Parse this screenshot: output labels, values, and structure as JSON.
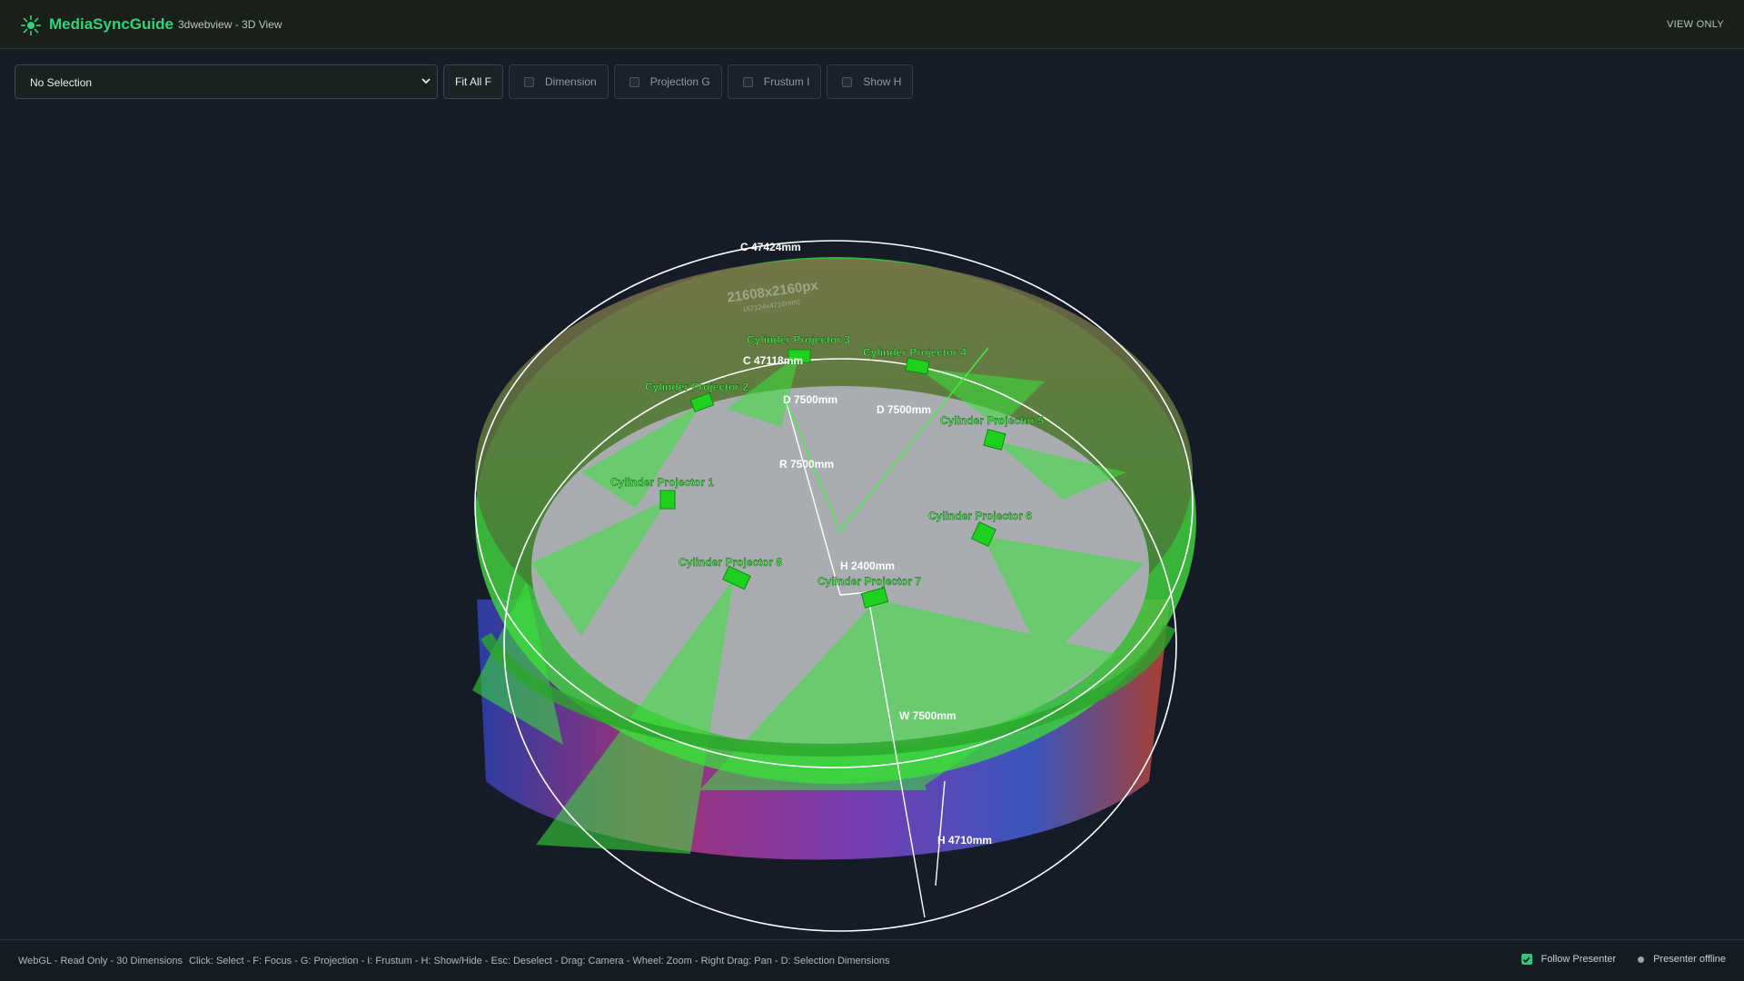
{
  "header": {
    "app_title": "MediaSyncGuide",
    "subtitle": "3dwebview - 3D View",
    "mode_badge": "VIEW ONLY"
  },
  "toolbar": {
    "selection_value": "No Selection",
    "fit_all_label": "Fit All F",
    "toggles": [
      {
        "label": "Dimension",
        "checked": false
      },
      {
        "label": "Projection G",
        "checked": false
      },
      {
        "label": "Frustum I",
        "checked": false
      },
      {
        "label": "Show H",
        "checked": false
      }
    ]
  },
  "scene": {
    "screen_resolution": "21608x2160px",
    "screen_size": "(47124x4710mm)",
    "dimensions": {
      "outer_circumference": "C 47424mm",
      "inner_circumference": "C 47118mm",
      "distance_a": "D 7500mm",
      "distance_b": "D 7500mm",
      "radius": "R 7500mm",
      "projector_height": "H 2400mm",
      "width": "W 7500mm",
      "screen_height": "H 4710mm"
    },
    "projectors": [
      "Cylinder Projector 1",
      "Cylinder Projector 2",
      "Cylinder Projector 3",
      "Cylinder Projector 4",
      "Cylinder Projector 5",
      "Cylinder Projector 6",
      "Cylinder Projector 7",
      "Cylinder Projector 8"
    ],
    "colors": {
      "accent": "#34d27a",
      "projector": "#1fd11f",
      "floor": "#a9adb2",
      "wall_outer_gradient": [
        "#d93a8a",
        "#7a3fb8",
        "#3b58c4"
      ]
    }
  },
  "status": {
    "left": "WebGL - Read Only - 30 Dimensions",
    "help": "Click: Select - F: Focus - G: Projection - I: Frustum - H: Show/Hide - Esc: Deselect - Drag: Camera - Wheel: Zoom - Right Drag: Pan - D: Selection Dimensions",
    "follow_presenter_label": "Follow Presenter",
    "follow_presenter_checked": true,
    "presenter_status": "Presenter offline"
  }
}
